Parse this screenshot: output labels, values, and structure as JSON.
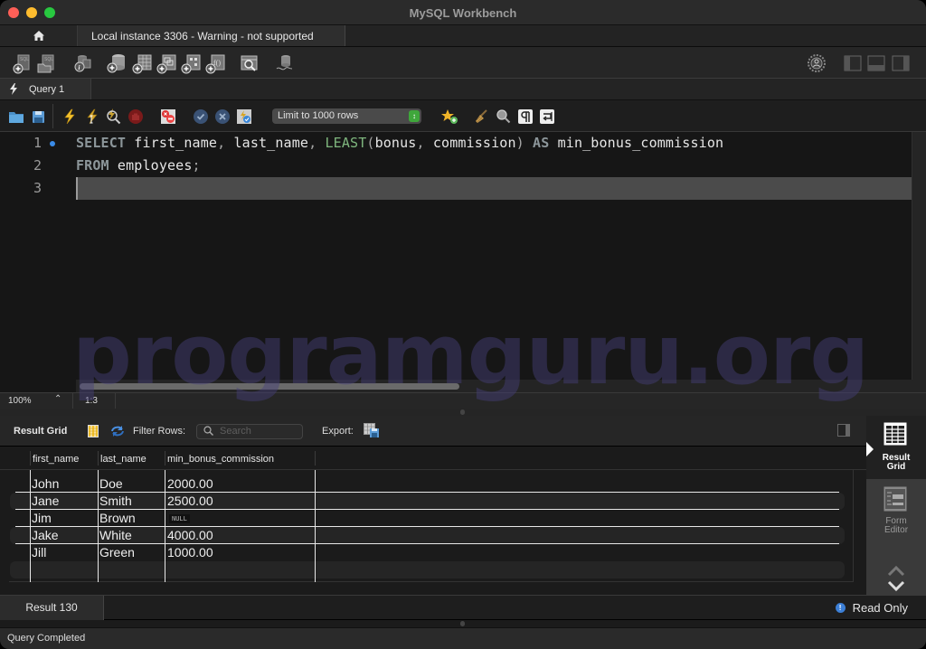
{
  "window": {
    "title": "MySQL Workbench"
  },
  "connection_tabs": {
    "home_icon": "home-icon",
    "active_tab": "Local instance 3306 - Warning - not supported"
  },
  "main_toolbar": {
    "icons": [
      "new-sql-tab-icon",
      "open-sql-file-icon",
      "schema-inspector-icon",
      "create-schema-icon",
      "create-table-icon",
      "create-view-icon",
      "create-procedure-icon",
      "create-function-icon",
      "search-table-data-icon",
      "reconnect-icon"
    ],
    "layout_icons": [
      "preferences-icon",
      "toggle-sidebar-icon",
      "toggle-output-icon",
      "toggle-secondary-sidebar-icon"
    ]
  },
  "query_tabs": [
    {
      "label": "Query 1",
      "icon": "lightning-icon",
      "active": true
    }
  ],
  "sql_toolbar": {
    "icons": [
      "open-file-icon",
      "save-icon",
      "execute-icon",
      "execute-current-icon",
      "explain-icon",
      "stop-icon",
      "toggle-error-icon",
      "commit-icon",
      "rollback-icon",
      "autocommit-icon"
    ],
    "limit_select": "Limit to 1000 rows",
    "right_icons": [
      "add-snippet-icon",
      "beautify-icon",
      "find-icon",
      "invisible-chars-icon",
      "wrap-lines-icon"
    ]
  },
  "editor": {
    "line_numbers": [
      "1",
      "2",
      "3"
    ],
    "lines": [
      [
        {
          "t": "kw",
          "v": "SELECT"
        },
        {
          "t": "id",
          "v": " first_name"
        },
        {
          "t": "punc",
          "v": ","
        },
        {
          "t": "id",
          "v": " last_name"
        },
        {
          "t": "punc",
          "v": ","
        },
        {
          "t": "id",
          "v": " "
        },
        {
          "t": "fn",
          "v": "LEAST"
        },
        {
          "t": "punc",
          "v": "("
        },
        {
          "t": "id",
          "v": "bonus"
        },
        {
          "t": "punc",
          "v": ","
        },
        {
          "t": "id",
          "v": " commission"
        },
        {
          "t": "punc",
          "v": ")"
        },
        {
          "t": "id",
          "v": " "
        },
        {
          "t": "kw",
          "v": "AS"
        },
        {
          "t": "id",
          "v": " min_bonus_commission"
        }
      ],
      [
        {
          "t": "kw",
          "v": "FROM"
        },
        {
          "t": "id",
          "v": " employees"
        },
        {
          "t": "punc",
          "v": ";"
        }
      ],
      []
    ],
    "zoom": "100%",
    "cursor_position": "1:3"
  },
  "watermark": "programguru.org",
  "result": {
    "toolbar": {
      "title": "Result Grid",
      "filter_label": "Filter Rows:",
      "search_placeholder": "Search",
      "export_label": "Export:"
    },
    "columns": [
      "first_name",
      "last_name",
      "min_bonus_commission"
    ],
    "rows": [
      [
        "John",
        "Doe",
        "2000.00"
      ],
      [
        "Jane",
        "Smith",
        "2500.00"
      ],
      [
        "Jim",
        "Brown",
        null
      ],
      [
        "Jake",
        "White",
        "4000.00"
      ],
      [
        "Jill",
        "Green",
        "1000.00"
      ]
    ],
    "null_label": "NULL",
    "side_panel": {
      "result_grid_label_1": "Result",
      "result_grid_label_2": "Grid",
      "form_editor_label_1": "Form",
      "form_editor_label_2": "Editor"
    },
    "tab_label": "Result 130",
    "read_only": "Read Only"
  },
  "status": {
    "message": "Query Completed"
  }
}
